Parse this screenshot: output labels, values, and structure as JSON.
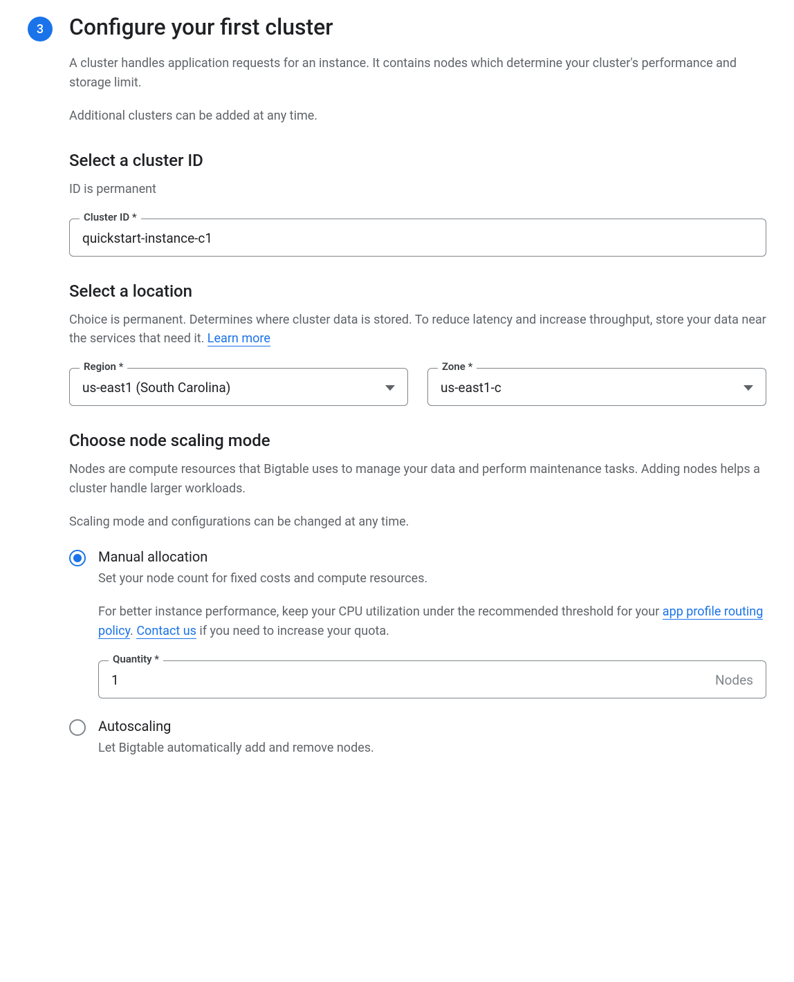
{
  "step": {
    "number": "3",
    "title": "Configure your first cluster",
    "description": "A cluster handles application requests for an instance. It contains nodes which determine your cluster's performance and storage limit.",
    "description2": "Additional clusters can be added at any time."
  },
  "cluster_id": {
    "heading": "Select a cluster ID",
    "note": "ID is permanent",
    "label": "Cluster ID *",
    "value": "quickstart-instance-c1"
  },
  "location": {
    "heading": "Select a location",
    "description_pre": "Choice is permanent. Determines where cluster data is stored. To reduce latency and increase throughput, store your data near the services that need it. ",
    "learn_more": "Learn more",
    "region_label": "Region *",
    "region_value": "us-east1 (South Carolina)",
    "zone_label": "Zone *",
    "zone_value": "us-east1-c"
  },
  "scaling": {
    "heading": "Choose node scaling mode",
    "description1": "Nodes are compute resources that Bigtable uses to manage your data and perform maintenance tasks. Adding nodes helps a cluster handle larger workloads.",
    "description2": "Scaling mode and configurations can be changed at any time.",
    "manual": {
      "title": "Manual allocation",
      "subtitle": "Set your node count for fixed costs and compute resources.",
      "perf_pre": "For better instance performance, keep your CPU utilization under the recommended threshold for your ",
      "link1": "app profile routing policy",
      "perf_mid": ". ",
      "link2": "Contact us",
      "perf_post": " if you need to increase your quota.",
      "quantity_label": "Quantity *",
      "quantity_value": "1",
      "quantity_suffix": "Nodes"
    },
    "autoscaling": {
      "title": "Autoscaling",
      "subtitle": "Let Bigtable automatically add and remove nodes."
    }
  }
}
